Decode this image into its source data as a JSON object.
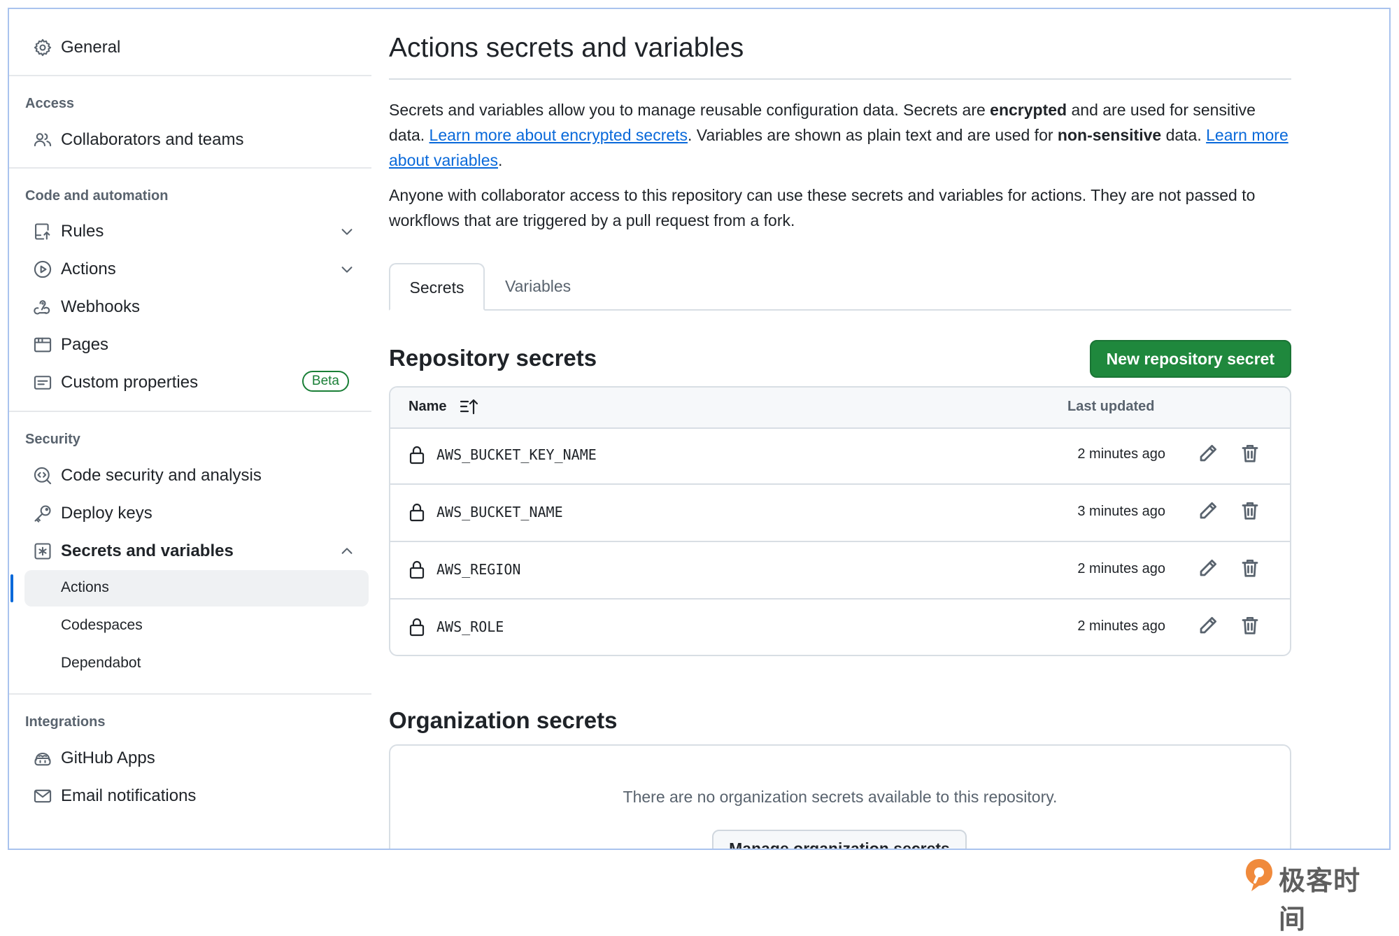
{
  "sidebar": {
    "general": "General",
    "groups": {
      "access": "Access",
      "code": "Code and automation",
      "security": "Security",
      "integrations": "Integrations"
    },
    "items": {
      "collaborators": "Collaborators and teams",
      "rules": "Rules",
      "actions": "Actions",
      "webhooks": "Webhooks",
      "pages": "Pages",
      "custom_properties": "Custom properties",
      "beta": "Beta",
      "code_security": "Code security and analysis",
      "deploy_keys": "Deploy keys",
      "secrets_variables": "Secrets and variables",
      "github_apps": "GitHub Apps",
      "email_notifications": "Email notifications"
    },
    "sub_items": {
      "actions": "Actions",
      "codespaces": "Codespaces",
      "dependabot": "Dependabot"
    }
  },
  "main": {
    "title": "Actions secrets and variables",
    "intro": {
      "p1_a": "Secrets and variables allow you to manage reusable configuration data. Secrets are ",
      "p1_b": "encrypted",
      "p1_c": " and are used for sensitive data. ",
      "link1": "Learn more about encrypted secrets",
      "p1_d": ". Variables are shown as plain text and are used for ",
      "p1_e": "non-sensitive",
      "p1_f": " data. ",
      "link2": "Learn more about variables",
      "p1_g": "."
    },
    "p2": "Anyone with collaborator access to this repository can use these secrets and variables for actions. They are not passed to workflows that are triggered by a pull request from a fork.",
    "tabs": {
      "secrets": "Secrets",
      "variables": "Variables"
    },
    "repo_secrets": {
      "heading": "Repository secrets",
      "new_button": "New repository secret",
      "col_name": "Name",
      "col_updated": "Last updated",
      "rows": [
        {
          "name": "AWS_BUCKET_KEY_NAME",
          "updated": "2 minutes ago"
        },
        {
          "name": "AWS_BUCKET_NAME",
          "updated": "3 minutes ago"
        },
        {
          "name": "AWS_REGION",
          "updated": "2 minutes ago"
        },
        {
          "name": "AWS_ROLE",
          "updated": "2 minutes ago"
        }
      ]
    },
    "org_secrets": {
      "heading": "Organization secrets",
      "empty": "There are no organization secrets available to this repository.",
      "manage_button": "Manage organization secrets"
    }
  },
  "watermark": {
    "text": "极客时间"
  }
}
